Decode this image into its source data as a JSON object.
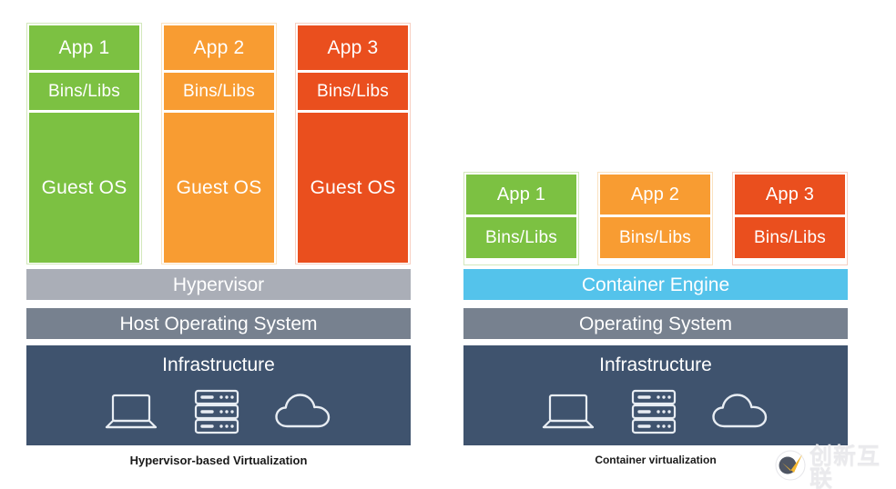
{
  "left": {
    "caption": "Hypervisor-based Virtualization",
    "columns": [
      {
        "app": "App 1",
        "bins": "Bins/Libs",
        "guest": "Guest OS",
        "color": "#7cc142"
      },
      {
        "app": "App 2",
        "bins": "Bins/Libs",
        "guest": "Guest OS",
        "color": "#f89c32"
      },
      {
        "app": "App 3",
        "bins": "Bins/Libs",
        "guest": "Guest OS",
        "color": "#ea4f1e"
      }
    ],
    "layers": [
      {
        "label": "Hypervisor",
        "color": "#aaaeb7"
      },
      {
        "label": "Host Operating System",
        "color": "#77818f"
      },
      {
        "label": "Infrastructure",
        "color": "#3f536e"
      }
    ]
  },
  "right": {
    "caption": "Container virtualization",
    "columns": [
      {
        "app": "App 1",
        "bins": "Bins/Libs",
        "color": "#7cc142"
      },
      {
        "app": "App 2",
        "bins": "Bins/Libs",
        "color": "#f89c32"
      },
      {
        "app": "App 3",
        "bins": "Bins/Libs",
        "color": "#ea4f1e"
      }
    ],
    "layers": [
      {
        "label": "Container Engine",
        "color": "#54c3eb"
      },
      {
        "label": "Operating System",
        "color": "#77818f"
      },
      {
        "label": "Infrastructure",
        "color": "#3f536e"
      }
    ]
  },
  "icons": {
    "laptop": "laptop-icon",
    "server": "server-rack-icon",
    "cloud": "cloud-icon"
  },
  "watermark": {
    "text": "创新互联",
    "logo": "check-circle-logo"
  }
}
